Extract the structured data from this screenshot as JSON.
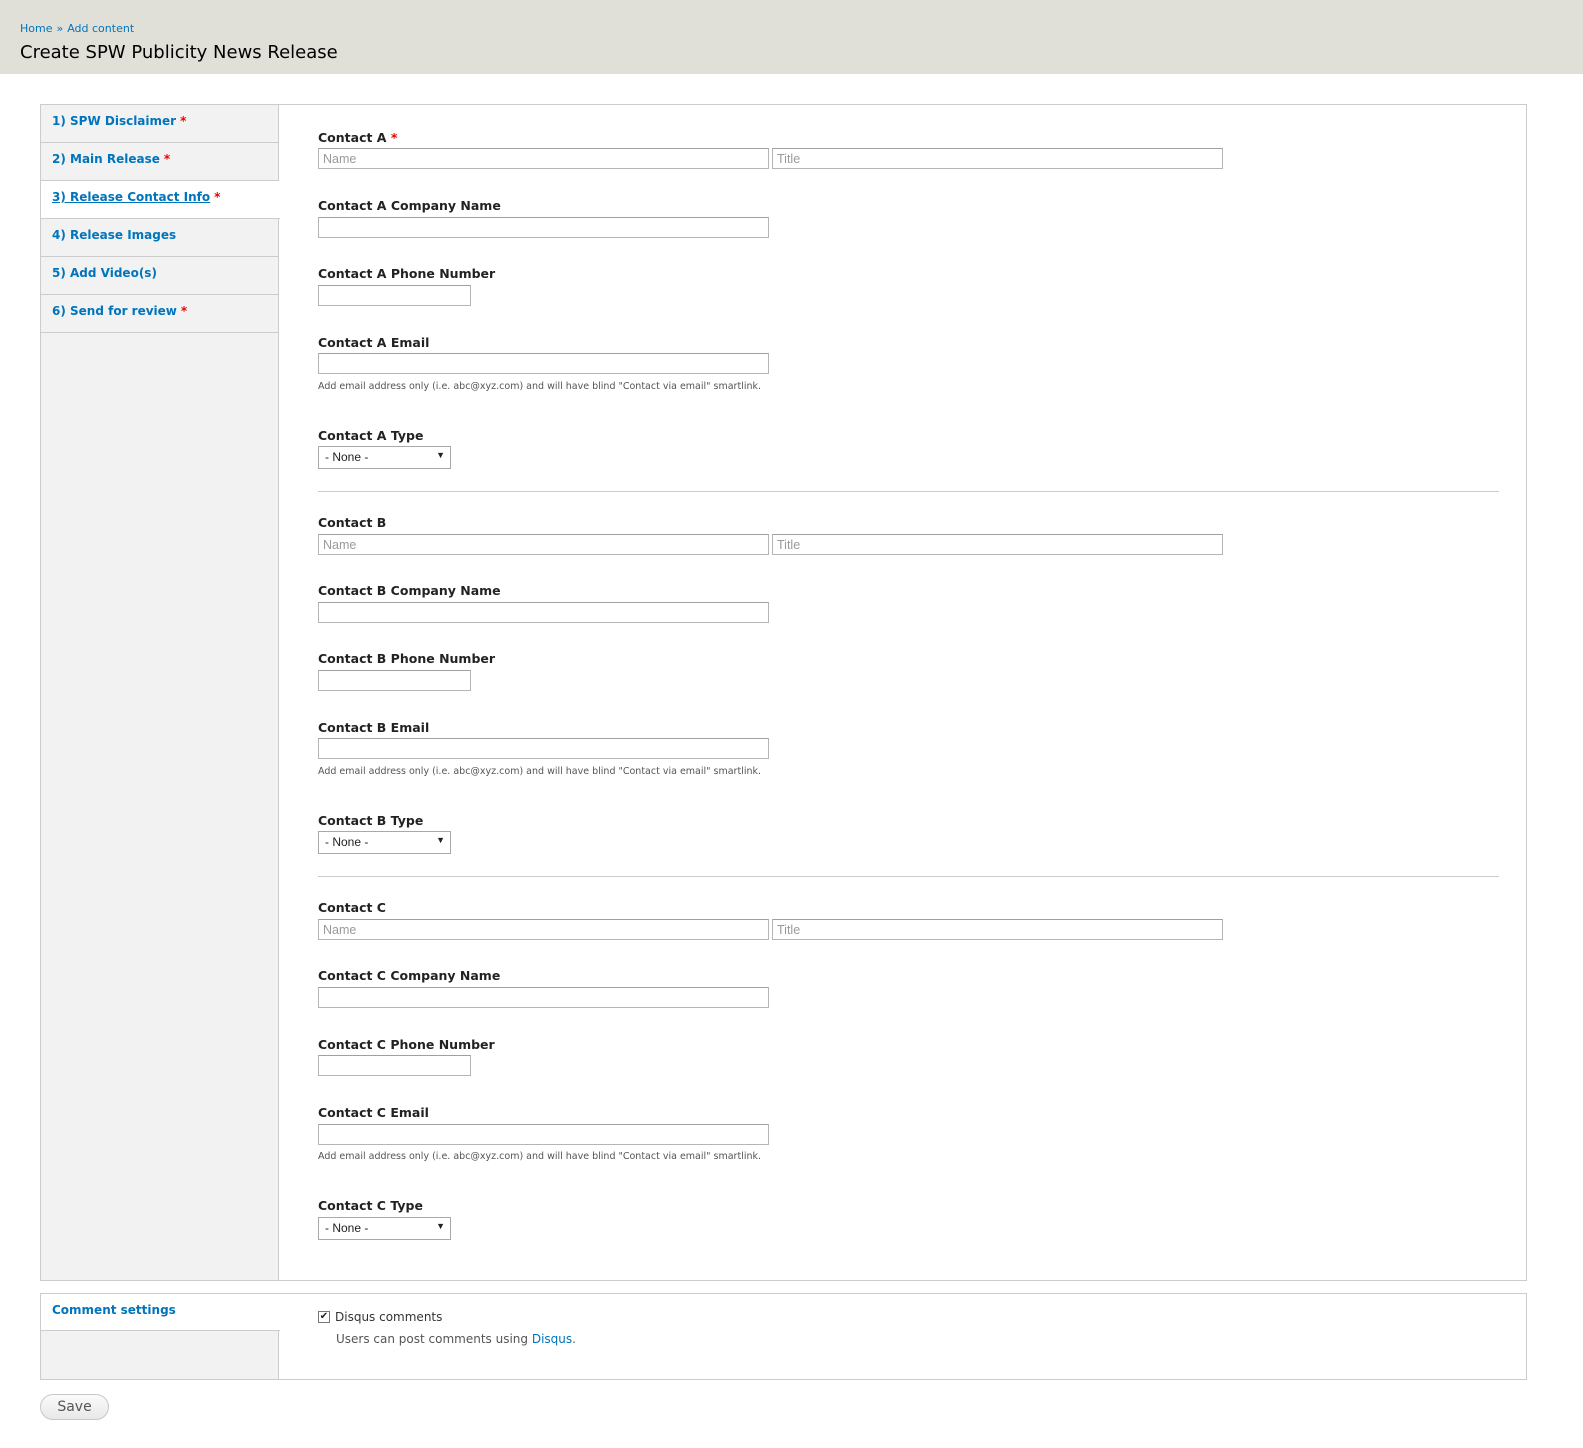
{
  "breadcrumb": {
    "home": "Home",
    "sep": "»",
    "add_content": "Add content"
  },
  "page_title": "Create SPW Publicity News Release",
  "tabs": [
    {
      "label": "1) SPW Disclaimer",
      "required": "*"
    },
    {
      "label": "2) Main Release",
      "required": "*"
    },
    {
      "label": "3) Release Contact Info",
      "required": "*"
    },
    {
      "label": "4) Release Images"
    },
    {
      "label": "5) Add Video(s)"
    },
    {
      "label": "6) Send for review",
      "required": "*"
    }
  ],
  "contacts": {
    "a": {
      "label": "Contact A",
      "required": "*",
      "name_placeholder": "Name",
      "title_placeholder": "Title",
      "company_label": "Contact A Company Name",
      "phone_label": "Contact A Phone Number",
      "email_label": "Contact A Email",
      "email_help": "Add email address only (i.e. abc@xyz.com) and will have blind \"Contact via email\" smartlink.",
      "type_label": "Contact A Type",
      "type_value": "- None -"
    },
    "b": {
      "label": "Contact B",
      "name_placeholder": "Name",
      "title_placeholder": "Title",
      "company_label": "Contact B Company Name",
      "phone_label": "Contact B Phone Number",
      "email_label": "Contact B Email",
      "email_help": "Add email address only (i.e. abc@xyz.com) and will have blind \"Contact via email\" smartlink.",
      "type_label": "Contact B Type",
      "type_value": "- None -"
    },
    "c": {
      "label": "Contact C",
      "name_placeholder": "Name",
      "title_placeholder": "Title",
      "company_label": "Contact C Company Name",
      "phone_label": "Contact C Phone Number",
      "email_label": "Contact C Email",
      "email_help": "Add email address only (i.e. abc@xyz.com) and will have blind \"Contact via email\" smartlink.",
      "type_label": "Contact C Type",
      "type_value": "- None -"
    }
  },
  "comment_settings": {
    "tab_label": "Comment settings",
    "checkbox_label": "Disqus comments",
    "checked": true,
    "description_prefix": "Users can post comments using ",
    "description_link": "Disqus",
    "description_suffix": "."
  },
  "save_label": "Save",
  "icons": {
    "select_arrow": "chevron-down-icon",
    "checkbox_check": "check-icon"
  },
  "colors": {
    "link": "#0074bd",
    "required": "#e00000",
    "header_bg": "#e1e0d8",
    "tab_bg": "#f2f2f2"
  }
}
